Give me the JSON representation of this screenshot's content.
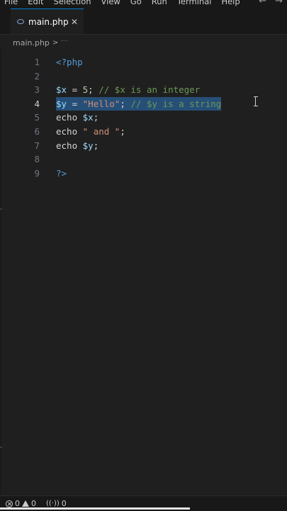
{
  "menu": [
    "File",
    "Edit",
    "Selection",
    "View",
    "Go",
    "Run",
    "Terminal",
    "Help"
  ],
  "nav": {
    "back": "←",
    "forward": "→"
  },
  "tab": {
    "filename": "main.php",
    "close": "✕"
  },
  "breadcrumb": {
    "file": "main.php",
    "chevron": ">"
  },
  "editor": {
    "lines": [
      {
        "n": "1",
        "tokens": [
          {
            "t": "<?php",
            "c": "tag"
          }
        ]
      },
      {
        "n": "2",
        "tokens": []
      },
      {
        "n": "3",
        "tokens": [
          {
            "t": "$x",
            "c": "var"
          },
          {
            "t": " = ",
            "c": "op"
          },
          {
            "t": "5",
            "c": "num"
          },
          {
            "t": "; ",
            "c": "op"
          },
          {
            "t": "// $x is an integer",
            "c": "cmt"
          }
        ]
      },
      {
        "n": "4",
        "active": true,
        "selected": true,
        "tokens": [
          {
            "t": "$y",
            "c": "var"
          },
          {
            "t": " = ",
            "c": "op"
          },
          {
            "t": "\"Hello\"",
            "c": "str"
          },
          {
            "t": "; ",
            "c": "op"
          },
          {
            "t": "// $y is a string",
            "c": "cmt"
          }
        ]
      },
      {
        "n": "5",
        "tokens": [
          {
            "t": "echo ",
            "c": "kw"
          },
          {
            "t": "$x",
            "c": "var"
          },
          {
            "t": ";",
            "c": "op"
          }
        ]
      },
      {
        "n": "6",
        "tokens": [
          {
            "t": "echo ",
            "c": "kw"
          },
          {
            "t": "\" and \"",
            "c": "str"
          },
          {
            "t": ";",
            "c": "op"
          }
        ]
      },
      {
        "n": "7",
        "tokens": [
          {
            "t": "echo ",
            "c": "kw"
          },
          {
            "t": "$y",
            "c": "var"
          },
          {
            "t": ";",
            "c": "op"
          }
        ]
      },
      {
        "n": "8",
        "tokens": []
      },
      {
        "n": "9",
        "tokens": [
          {
            "t": "?>",
            "c": "tag"
          }
        ]
      }
    ]
  },
  "status": {
    "errors": "0",
    "warnings": "0",
    "ports": "0"
  },
  "colors": {
    "accent": "#0078d4",
    "selection": "#264f78",
    "background": "#1f1f1f"
  }
}
